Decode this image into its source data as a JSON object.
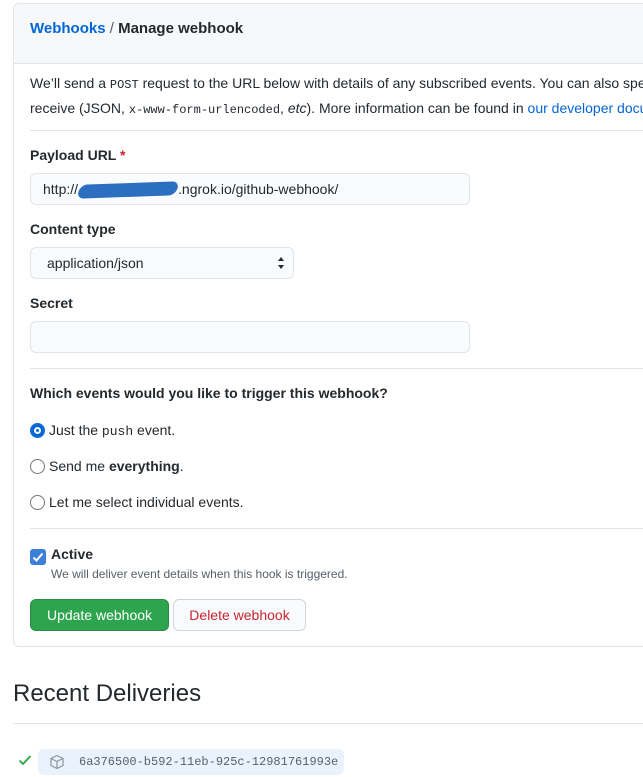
{
  "breadcrumb": {
    "parent": "Webhooks",
    "separator": "/",
    "current": "Manage webhook"
  },
  "intro": {
    "line1_a": "We’ll send a ",
    "line1_code": "POST",
    "line1_b": " request to the URL below with details of any subscribed events. You can also spe",
    "line2_a": "receive (JSON, ",
    "line2_code": "x-www-form-urlencoded",
    "line2_b": ", ",
    "line2_em": "etc",
    "line2_c": "). More information can be found in ",
    "line2_link": "our developer docu"
  },
  "payload_url": {
    "label": "Payload URL",
    "required_mark": "*",
    "value_prefix": "http://",
    "value_suffix": ".ngrok.io/github-webhook/"
  },
  "content_type": {
    "label": "Content type",
    "selected": "application/json"
  },
  "secret": {
    "label": "Secret",
    "value": ""
  },
  "events": {
    "question": "Which events would you like to trigger this webhook?",
    "options": [
      {
        "pre": "Just the ",
        "code": "push",
        "post": " event.",
        "selected": true
      },
      {
        "pre": "Send me ",
        "bold": "everything",
        "post": ".",
        "selected": false
      },
      {
        "pre": "Let me select individual events.",
        "selected": false
      }
    ]
  },
  "active": {
    "label": "Active",
    "checked": true,
    "note": "We will deliver event details when this hook is triggered."
  },
  "buttons": {
    "update": "Update webhook",
    "delete": "Delete webhook"
  },
  "deliveries": {
    "title": "Recent Deliveries",
    "items": [
      {
        "guid": "6a376500-b592-11eb-925c-12981761993e",
        "status": "success"
      }
    ]
  },
  "colors": {
    "link": "#0366d6",
    "primary": "#2ea44f",
    "danger": "#cb2431",
    "success": "#28a745"
  }
}
